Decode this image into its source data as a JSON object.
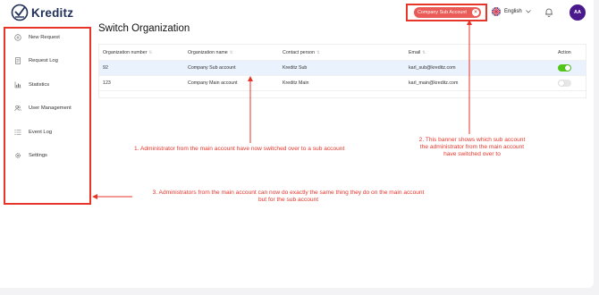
{
  "brand": {
    "name": "Kreditz"
  },
  "header": {
    "org_banner": "Company Sub Account",
    "language": "English",
    "avatar_initials": "AA"
  },
  "sidebar": {
    "items": [
      {
        "label": "New Request",
        "icon": "plus-circle-icon"
      },
      {
        "label": "Request Log",
        "icon": "document-icon"
      },
      {
        "label": "Statistics",
        "icon": "bar-chart-icon"
      },
      {
        "label": "User Management",
        "icon": "users-icon"
      },
      {
        "label": "Event Log",
        "icon": "list-icon"
      },
      {
        "label": "Settings",
        "icon": "gear-icon"
      }
    ]
  },
  "page": {
    "title": "Switch Organization"
  },
  "table": {
    "columns": [
      "Organization number",
      "Organization name",
      "Contact person",
      "Email",
      "Action"
    ],
    "rows": [
      {
        "number": "92",
        "name": "Company Sub account",
        "contact": "Kreditz Sub",
        "email": "karl_sub@kreditz.com",
        "active": true
      },
      {
        "number": "123",
        "name": "Company Main account",
        "contact": "Kreditz Main",
        "email": "karl_main@kreditz.com",
        "active": false
      }
    ]
  },
  "annotations": {
    "note1": "1. Administrator from the main account have now switched over to a sub account",
    "note2_line1": "2. This banner shows which sub account",
    "note2_line2": "the administrator from the main account",
    "note2_line3": "have switched over to",
    "note3_line1": "3. Administrators from the main account can now do exactly the same thing they do on the main account",
    "note3_line2": "but for the sub account"
  },
  "colors": {
    "annotation": "#e8352a",
    "banner": "#ea5a56",
    "toggle_on": "#52c41a",
    "avatar": "#4a1a8c",
    "selected_row": "#eaf2fd"
  }
}
